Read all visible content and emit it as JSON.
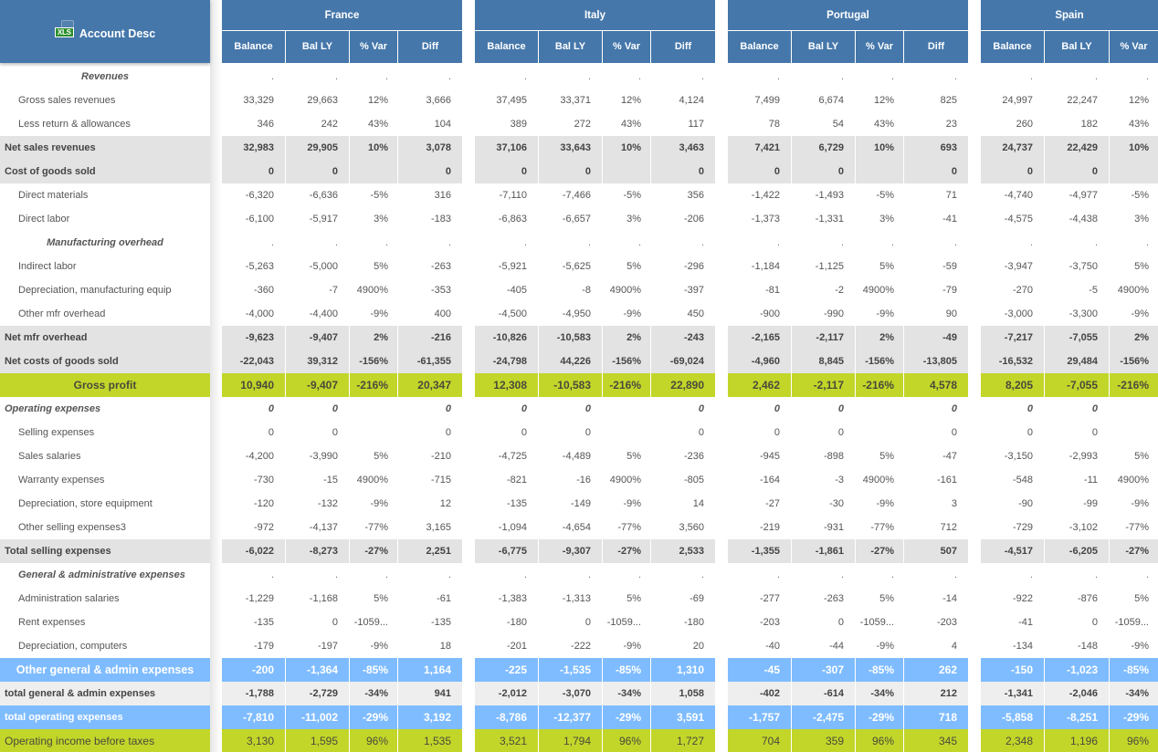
{
  "header": {
    "account_desc_label": "Account Desc",
    "xls_icon_label": "XLS",
    "column_labels": [
      "Balance",
      "Bal LY",
      "% Var",
      "Diff"
    ]
  },
  "rows": [
    {
      "label": "Revenues",
      "type": "section"
    },
    {
      "label": "Gross sales revenues",
      "type": "detail"
    },
    {
      "label": "Less return & allowances",
      "type": "detail"
    },
    {
      "label": "Net sales revenues",
      "type": "subtotal"
    },
    {
      "label": "Cost of goods sold",
      "type": "subtotal"
    },
    {
      "label": "Direct materials",
      "type": "detail"
    },
    {
      "label": "Direct labor",
      "type": "detail"
    },
    {
      "label": "Manufacturing overhead",
      "type": "section"
    },
    {
      "label": "Indirect labor",
      "type": "detail"
    },
    {
      "label": "Depreciation, manufacturing equip",
      "type": "detail"
    },
    {
      "label": "Other mfr overhead",
      "type": "detail"
    },
    {
      "label": "Net mfr overhead",
      "type": "subtotal"
    },
    {
      "label": "Net costs of goods sold",
      "type": "subtotal"
    },
    {
      "label": "Gross profit",
      "type": "gross"
    },
    {
      "label": "Operating expenses",
      "type": "opex"
    },
    {
      "label": "Selling expenses",
      "type": "detail"
    },
    {
      "label": "Sales salaries",
      "type": "detail"
    },
    {
      "label": "Warranty expenses",
      "type": "detail"
    },
    {
      "label": "Depreciation, store equipment",
      "type": "detail"
    },
    {
      "label": "Other selling expenses3",
      "type": "detail"
    },
    {
      "label": "Total selling expenses",
      "type": "subtotal"
    },
    {
      "label": "General & administrative expenses",
      "type": "gasection"
    },
    {
      "label": "Administration salaries",
      "type": "detail"
    },
    {
      "label": "Rent expenses",
      "type": "detail"
    },
    {
      "label": "Depreciation, computers",
      "type": "detail"
    },
    {
      "label": "Other general & admin expenses",
      "type": "blue-c"
    },
    {
      "label": "total general & admin expenses",
      "type": "grey2"
    },
    {
      "label": "total operating expenses",
      "type": "blue-l"
    },
    {
      "label": "Operating income before taxes",
      "type": "green-l"
    }
  ],
  "countries": [
    {
      "name": "France",
      "values": [
        [
          ".",
          ".",
          ".",
          "."
        ],
        [
          "33,329",
          "29,663",
          "12%",
          "3,666"
        ],
        [
          "346",
          "242",
          "43%",
          "104"
        ],
        [
          "32,983",
          "29,905",
          "10%",
          "3,078"
        ],
        [
          "0",
          "0",
          "",
          "0"
        ],
        [
          "-6,320",
          "-6,636",
          "-5%",
          "316"
        ],
        [
          "-6,100",
          "-5,917",
          "3%",
          "-183"
        ],
        [
          ".",
          ".",
          ".",
          "."
        ],
        [
          "-5,263",
          "-5,000",
          "5%",
          "-263"
        ],
        [
          "-360",
          "-7",
          "4900%",
          "-353"
        ],
        [
          "-4,000",
          "-4,400",
          "-9%",
          "400"
        ],
        [
          "-9,623",
          "-9,407",
          "2%",
          "-216"
        ],
        [
          "-22,043",
          "39,312",
          "-156%",
          "-61,355"
        ],
        [
          "10,940",
          "-9,407",
          "-216%",
          "20,347"
        ],
        [
          "0",
          "0",
          "",
          "0"
        ],
        [
          "0",
          "0",
          "",
          "0"
        ],
        [
          "-4,200",
          "-3,990",
          "5%",
          "-210"
        ],
        [
          "-730",
          "-15",
          "4900%",
          "-715"
        ],
        [
          "-120",
          "-132",
          "-9%",
          "12"
        ],
        [
          "-972",
          "-4,137",
          "-77%",
          "3,165"
        ],
        [
          "-6,022",
          "-8,273",
          "-27%",
          "2,251"
        ],
        [
          ".",
          ".",
          ".",
          "."
        ],
        [
          "-1,229",
          "-1,168",
          "5%",
          "-61"
        ],
        [
          "-135",
          "0",
          "-1059...",
          "-135"
        ],
        [
          "-179",
          "-197",
          "-9%",
          "18"
        ],
        [
          "-200",
          "-1,364",
          "-85%",
          "1,164"
        ],
        [
          "-1,788",
          "-2,729",
          "-34%",
          "941"
        ],
        [
          "-7,810",
          "-11,002",
          "-29%",
          "3,192"
        ],
        [
          "3,130",
          "1,595",
          "96%",
          "1,535"
        ]
      ]
    },
    {
      "name": "Italy",
      "values": [
        [
          ".",
          ".",
          ".",
          "."
        ],
        [
          "37,495",
          "33,371",
          "12%",
          "4,124"
        ],
        [
          "389",
          "272",
          "43%",
          "117"
        ],
        [
          "37,106",
          "33,643",
          "10%",
          "3,463"
        ],
        [
          "0",
          "0",
          "",
          "0"
        ],
        [
          "-7,110",
          "-7,466",
          "-5%",
          "356"
        ],
        [
          "-6,863",
          "-6,657",
          "3%",
          "-206"
        ],
        [
          ".",
          ".",
          ".",
          "."
        ],
        [
          "-5,921",
          "-5,625",
          "5%",
          "-296"
        ],
        [
          "-405",
          "-8",
          "4900%",
          "-397"
        ],
        [
          "-4,500",
          "-4,950",
          "-9%",
          "450"
        ],
        [
          "-10,826",
          "-10,583",
          "2%",
          "-243"
        ],
        [
          "-24,798",
          "44,226",
          "-156%",
          "-69,024"
        ],
        [
          "12,308",
          "-10,583",
          "-216%",
          "22,890"
        ],
        [
          "0",
          "0",
          "",
          "0"
        ],
        [
          "0",
          "0",
          "",
          "0"
        ],
        [
          "-4,725",
          "-4,489",
          "5%",
          "-236"
        ],
        [
          "-821",
          "-16",
          "4900%",
          "-805"
        ],
        [
          "-135",
          "-149",
          "-9%",
          "14"
        ],
        [
          "-1,094",
          "-4,654",
          "-77%",
          "3,560"
        ],
        [
          "-6,775",
          "-9,307",
          "-27%",
          "2,533"
        ],
        [
          ".",
          ".",
          ".",
          "."
        ],
        [
          "-1,383",
          "-1,313",
          "5%",
          "-69"
        ],
        [
          "-180",
          "0",
          "-1059...",
          "-180"
        ],
        [
          "-201",
          "-222",
          "-9%",
          "20"
        ],
        [
          "-225",
          "-1,535",
          "-85%",
          "1,310"
        ],
        [
          "-2,012",
          "-3,070",
          "-34%",
          "1,058"
        ],
        [
          "-8,786",
          "-12,377",
          "-29%",
          "3,591"
        ],
        [
          "3,521",
          "1,794",
          "96%",
          "1,727"
        ]
      ]
    },
    {
      "name": "Portugal",
      "values": [
        [
          ".",
          ".",
          ".",
          "."
        ],
        [
          "7,499",
          "6,674",
          "12%",
          "825"
        ],
        [
          "78",
          "54",
          "43%",
          "23"
        ],
        [
          "7,421",
          "6,729",
          "10%",
          "693"
        ],
        [
          "0",
          "0",
          "",
          "0"
        ],
        [
          "-1,422",
          "-1,493",
          "-5%",
          "71"
        ],
        [
          "-1,373",
          "-1,331",
          "3%",
          "-41"
        ],
        [
          ".",
          ".",
          ".",
          "."
        ],
        [
          "-1,184",
          "-1,125",
          "5%",
          "-59"
        ],
        [
          "-81",
          "-2",
          "4900%",
          "-79"
        ],
        [
          "-900",
          "-990",
          "-9%",
          "90"
        ],
        [
          "-2,165",
          "-2,117",
          "2%",
          "-49"
        ],
        [
          "-4,960",
          "8,845",
          "-156%",
          "-13,805"
        ],
        [
          "2,462",
          "-2,117",
          "-216%",
          "4,578"
        ],
        [
          "0",
          "0",
          "",
          "0"
        ],
        [
          "0",
          "0",
          "",
          "0"
        ],
        [
          "-945",
          "-898",
          "5%",
          "-47"
        ],
        [
          "-164",
          "-3",
          "4900%",
          "-161"
        ],
        [
          "-27",
          "-30",
          "-9%",
          "3"
        ],
        [
          "-219",
          "-931",
          "-77%",
          "712"
        ],
        [
          "-1,355",
          "-1,861",
          "-27%",
          "507"
        ],
        [
          ".",
          ".",
          ".",
          "."
        ],
        [
          "-277",
          "-263",
          "5%",
          "-14"
        ],
        [
          "-203",
          "0",
          "-1059...",
          "-203"
        ],
        [
          "-40",
          "-44",
          "-9%",
          "4"
        ],
        [
          "-45",
          "-307",
          "-85%",
          "262"
        ],
        [
          "-402",
          "-614",
          "-34%",
          "212"
        ],
        [
          "-1,757",
          "-2,475",
          "-29%",
          "718"
        ],
        [
          "704",
          "359",
          "96%",
          "345"
        ]
      ]
    },
    {
      "name": "Spain",
      "values": [
        [
          ".",
          ".",
          "."
        ],
        [
          "24,997",
          "22,247",
          "12%"
        ],
        [
          "260",
          "182",
          "43%"
        ],
        [
          "24,737",
          "22,429",
          "10%"
        ],
        [
          "0",
          "0",
          ""
        ],
        [
          "-4,740",
          "-4,977",
          "-5%"
        ],
        [
          "-4,575",
          "-4,438",
          "3%"
        ],
        [
          ".",
          ".",
          "."
        ],
        [
          "-3,947",
          "-3,750",
          "5%"
        ],
        [
          "-270",
          "-5",
          "4900%"
        ],
        [
          "-3,000",
          "-3,300",
          "-9%"
        ],
        [
          "-7,217",
          "-7,055",
          "2%"
        ],
        [
          "-16,532",
          "29,484",
          "-156%"
        ],
        [
          "8,205",
          "-7,055",
          "-216%"
        ],
        [
          "0",
          "0",
          ""
        ],
        [
          "0",
          "0",
          ""
        ],
        [
          "-3,150",
          "-2,993",
          "5%"
        ],
        [
          "-548",
          "-11",
          "4900%"
        ],
        [
          "-90",
          "-99",
          "-9%"
        ],
        [
          "-729",
          "-3,102",
          "-77%"
        ],
        [
          "-4,517",
          "-6,205",
          "-27%"
        ],
        [
          ".",
          ".",
          "."
        ],
        [
          "-922",
          "-876",
          "5%"
        ],
        [
          "-41",
          "0",
          "-1059..."
        ],
        [
          "-134",
          "-148",
          "-9%"
        ],
        [
          "-150",
          "-1,023",
          "-85%"
        ],
        [
          "-1,341",
          "-2,046",
          "-34%"
        ],
        [
          "-5,858",
          "-8,251",
          "-29%"
        ],
        [
          "2,348",
          "1,196",
          "96%"
        ]
      ]
    }
  ],
  "colors": {
    "header_blue": "#4577aa",
    "subtotal_grey": "#e3e3e3",
    "highlight_green": "#c2d62a",
    "highlight_blue": "#7fbcff",
    "xls_green": "#2c8f2c"
  }
}
